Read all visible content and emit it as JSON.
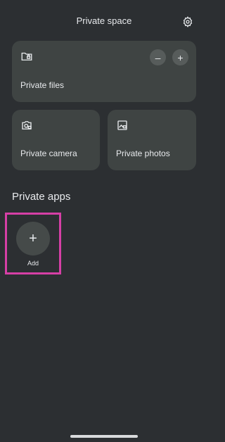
{
  "header": {
    "title": "Private space",
    "settings_icon": "gear-icon"
  },
  "tiles": {
    "files": {
      "label": "Private files",
      "icon": "folder-lock-icon",
      "minus_label": "–",
      "plus_label": "+"
    },
    "camera": {
      "label": "Private camera",
      "icon": "camera-lock-icon"
    },
    "photos": {
      "label": "Private photos",
      "icon": "photo-lock-icon"
    }
  },
  "private_apps": {
    "title": "Private apps",
    "add": {
      "symbol": "+",
      "label": "Add"
    }
  },
  "colors": {
    "background": "#2c2f32",
    "tile": "#3f4443",
    "highlight": "#d63fa6"
  }
}
